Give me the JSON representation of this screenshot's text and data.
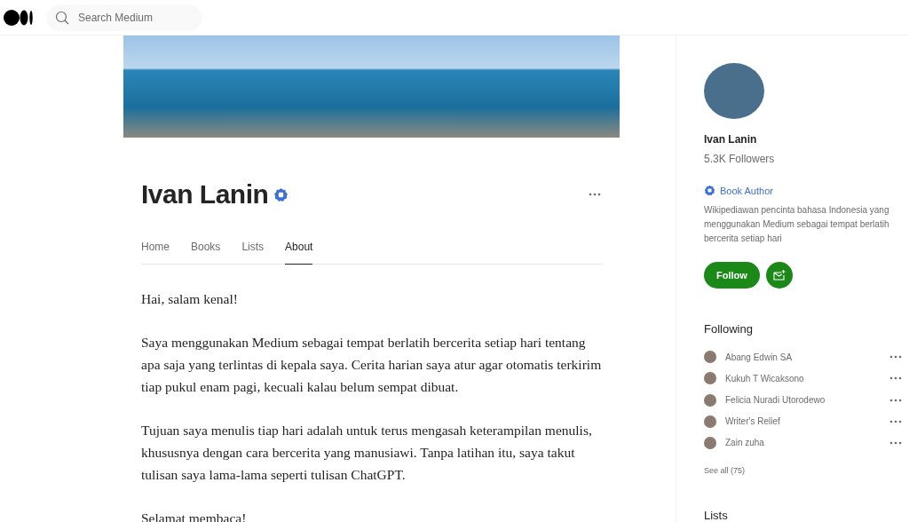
{
  "header": {
    "search": {
      "placeholder": "Search Medium"
    }
  },
  "profile": {
    "name": "Ivan Lanin",
    "verified": true,
    "tabs": [
      {
        "label": "Home",
        "selected": false
      },
      {
        "label": "Books",
        "selected": false
      },
      {
        "label": "Lists",
        "selected": false
      },
      {
        "label": "About",
        "selected": true
      }
    ],
    "about": [
      "Hai, salam kenal!",
      "Saya menggunakan Medium sebagai tempat berlatih bercerita setiap hari tentang apa saja yang terlintas di kepala saya. Cerita harian saya atur agar otomatis terkirim tiap pukul enam pagi, kecuali kalau belum sempat dibuat.",
      "Tujuan saya menulis tiap hari adalah untuk terus mengasah keterampilan menulis, khususnya dengan cara bercerita yang manusiawi. Tanpa latihan itu, saya takut tulisan saya lama-lama seperti tulisan ChatGPT.",
      "Selamat membaca!"
    ]
  },
  "sidebar": {
    "name": "Ivan Lanin",
    "followers": "5.3K Followers",
    "badge": "Book Author",
    "bio": "Wikipediawan pencinta bahasa Indonesia yang menggunakan Medium sebagai tempat berlatih bercerita setiap hari",
    "follow_button": "Follow",
    "following_title": "Following",
    "following": [
      {
        "name": "Abang Edwin SA"
      },
      {
        "name": "Kukuh T Wicaksono"
      },
      {
        "name": "Felicia Nuradi Utorodewo"
      },
      {
        "name": "Writer's Relief"
      },
      {
        "name": "Zain zuha"
      }
    ],
    "see_all": "See all (75)",
    "lists_title": "Lists"
  }
}
